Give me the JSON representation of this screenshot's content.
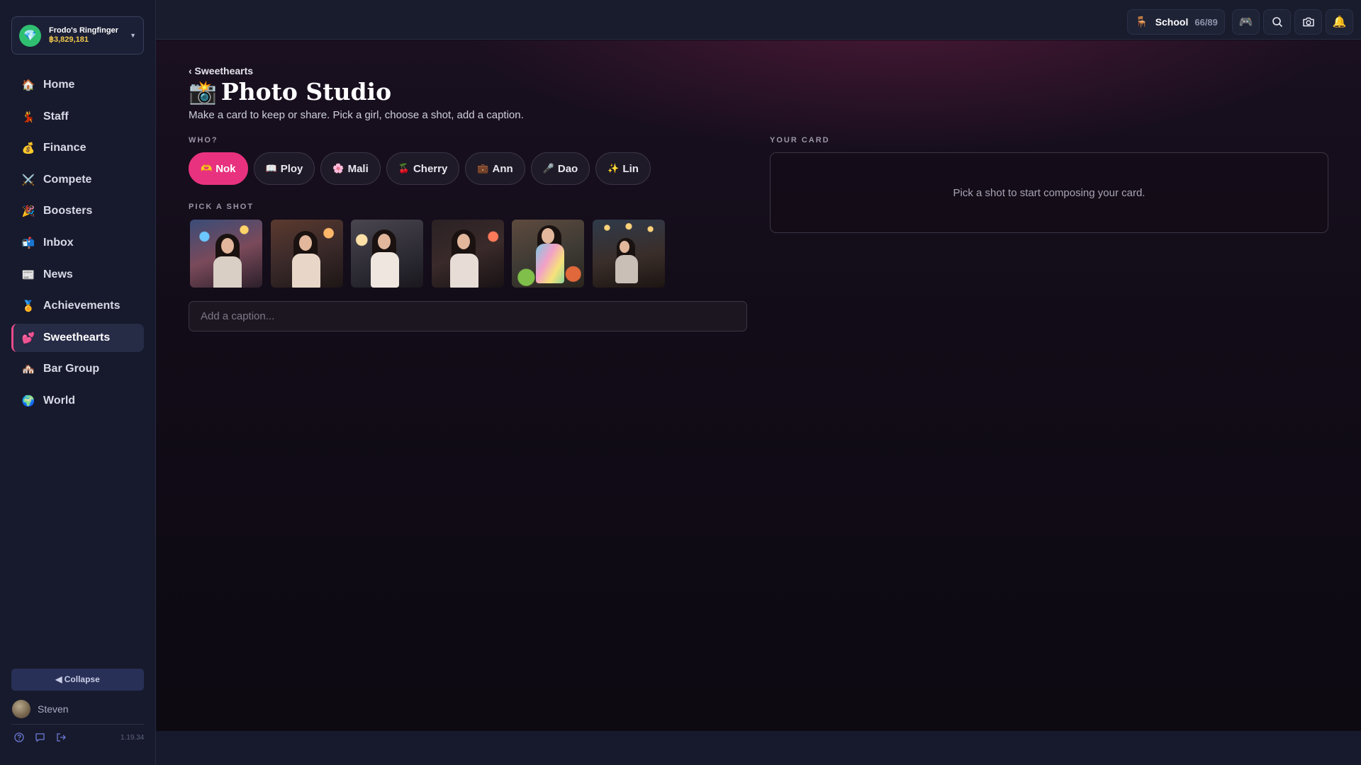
{
  "account": {
    "name": "Frodo's Ringfinger",
    "balance": "฿3,829,181",
    "gem_icon": "gem-icon"
  },
  "nav": [
    {
      "icon": "🏠",
      "label": "Home"
    },
    {
      "icon": "💃",
      "label": "Staff"
    },
    {
      "icon": "💰",
      "label": "Finance"
    },
    {
      "icon": "⚔️",
      "label": "Compete"
    },
    {
      "icon": "🎉",
      "label": "Boosters"
    },
    {
      "icon": "📬",
      "label": "Inbox"
    },
    {
      "icon": "📰",
      "label": "News"
    },
    {
      "icon": "🏅",
      "label": "Achievements"
    },
    {
      "icon": "💕",
      "label": "Sweethearts",
      "active": true
    },
    {
      "icon": "🏘️",
      "label": "Bar Group"
    },
    {
      "icon": "🌍",
      "label": "World"
    }
  ],
  "sidebar_footer": {
    "collapse_label": "◀ Collapse",
    "user_name": "Steven",
    "version": "1.19.34"
  },
  "topbar": {
    "school_icon": "🪑",
    "school_label": "School",
    "school_count": "66/89",
    "buttons": [
      "gamepad-icon",
      "search-icon",
      "camera-icon",
      "bell-icon"
    ]
  },
  "page": {
    "back_label": "‹ Sweethearts",
    "title_emoji": "📸",
    "title": "Photo Studio",
    "subtitle": "Make a card to keep or share. Pick a girl, choose a shot, add a caption.",
    "who_label": "WHO?",
    "shot_label": "PICK A SHOT",
    "caption_placeholder": "Add a caption...",
    "card_label": "YOUR CARD",
    "card_message": "Pick a shot to start composing your card."
  },
  "girls": [
    {
      "emoji": "🫶",
      "name": "Nok",
      "selected": true
    },
    {
      "emoji": "📖",
      "name": "Ploy"
    },
    {
      "emoji": "🌸",
      "name": "Mali"
    },
    {
      "emoji": "🍒",
      "name": "Cherry"
    },
    {
      "emoji": "💼",
      "name": "Ann"
    },
    {
      "emoji": "🎤",
      "name": "Dao"
    },
    {
      "emoji": "✨",
      "name": "Lin"
    }
  ],
  "colors": {
    "accent": "#e8327f",
    "sidebar_bg": "#171a2c",
    "balance": "#f2c94c"
  }
}
